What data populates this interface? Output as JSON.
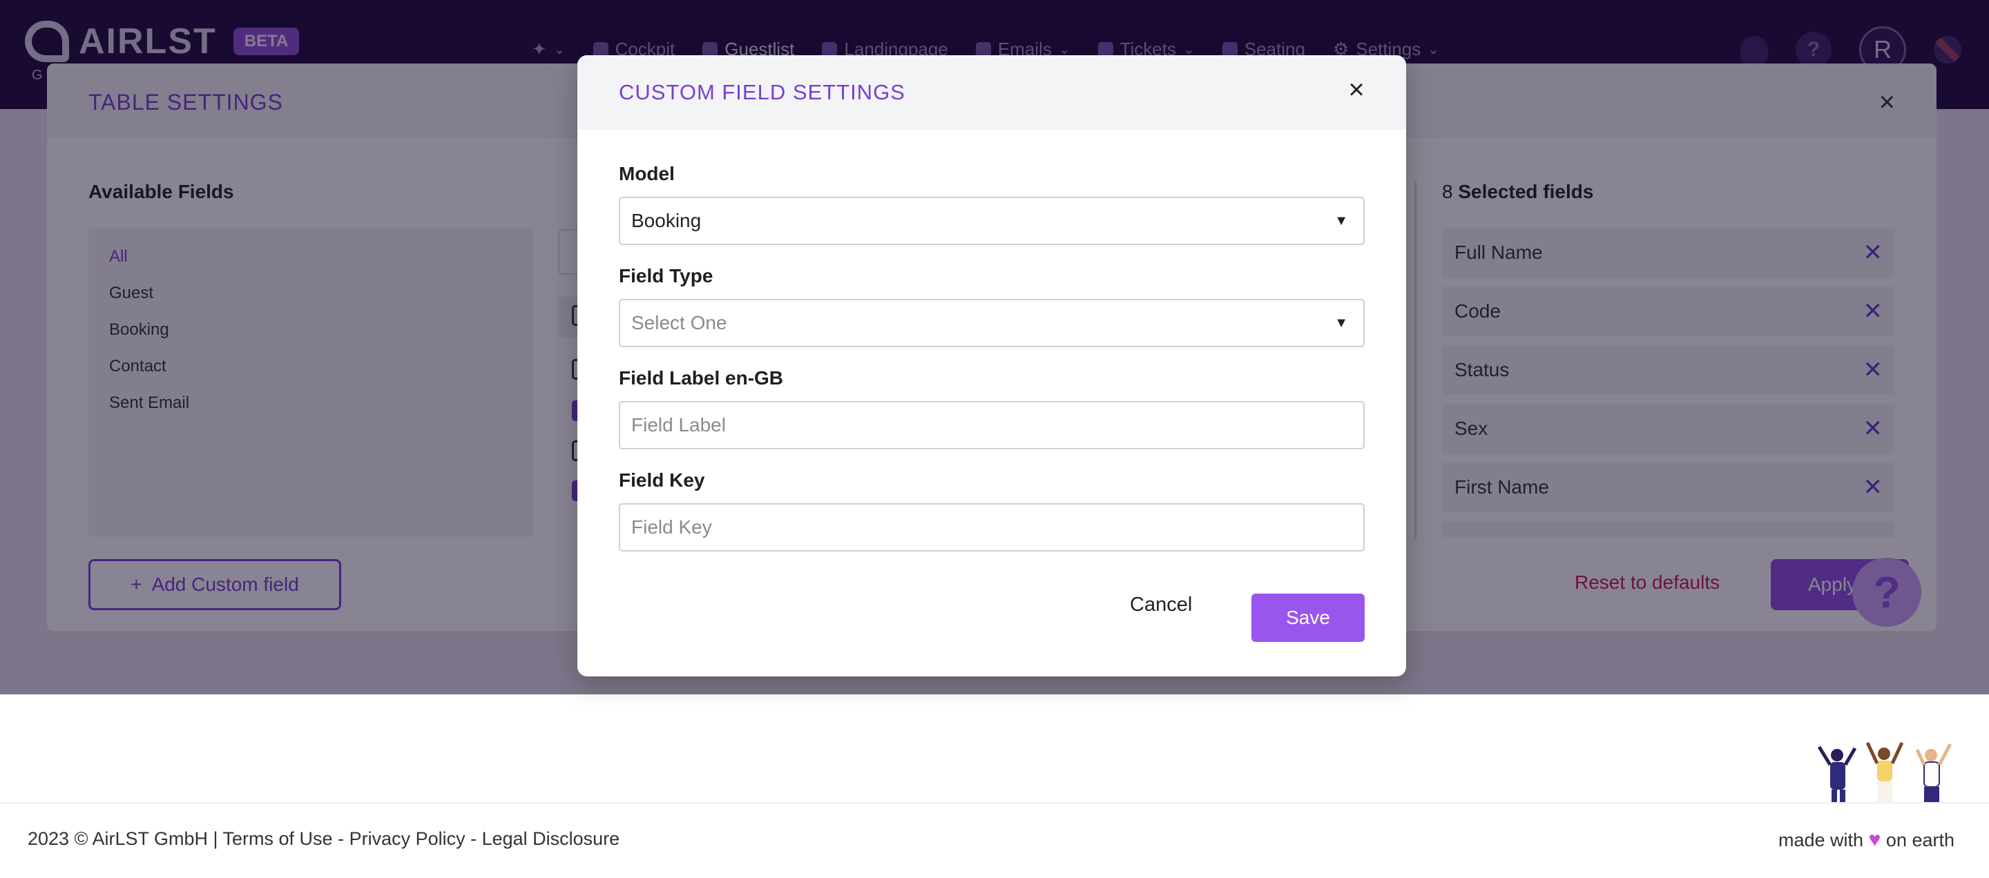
{
  "app": {
    "logo_text": "AIRLST",
    "beta_label": "BETA",
    "logo_sub": "G",
    "avatar_initial": "R",
    "help_glyph": "?"
  },
  "nav": {
    "items": [
      {
        "label": "Cockpit",
        "icon": "gauge-icon"
      },
      {
        "label": "Guestlist",
        "icon": "users-icon"
      },
      {
        "label": "Landingpage",
        "icon": "browser-icon"
      },
      {
        "label": "Emails",
        "icon": "envelope-icon"
      },
      {
        "label": "Tickets",
        "icon": "grid-icon"
      },
      {
        "label": "Seating",
        "icon": "chair-icon"
      },
      {
        "label": "Settings",
        "icon": "gear-icon"
      }
    ]
  },
  "table_settings": {
    "title": "TABLE SETTINGS",
    "available_title": "Available Fields",
    "available_items": [
      "All",
      "Guest",
      "Booking",
      "Contact",
      "Sent Email"
    ],
    "add_custom_label": "Add Custom field",
    "selected_count": "8",
    "selected_title": "Selected fields",
    "selected_items": [
      "Full Name",
      "Code",
      "Status",
      "Sex",
      "First Name"
    ],
    "reset_label": "Reset to defaults",
    "apply_label": "Apply"
  },
  "modal": {
    "title": "CUSTOM FIELD SETTINGS",
    "model_label": "Model",
    "model_value": "Booking",
    "field_type_label": "Field Type",
    "field_type_value": "Select One",
    "field_label_label": "Field Label en-GB",
    "field_label_placeholder": "Field Label",
    "field_key_label": "Field Key",
    "field_key_placeholder": "Field Key",
    "cancel_label": "Cancel",
    "save_label": "Save"
  },
  "footer": {
    "left": "2023 © AirLST GmbH | Terms of Use - Privacy Policy - Legal Disclosure",
    "made_with": "made with",
    "on_earth": "on earth"
  },
  "colors": {
    "accent": "#7a3fd1",
    "primary_button": "#9a55ef",
    "danger": "#c21f4d",
    "topbar": "#1e0b3c"
  }
}
